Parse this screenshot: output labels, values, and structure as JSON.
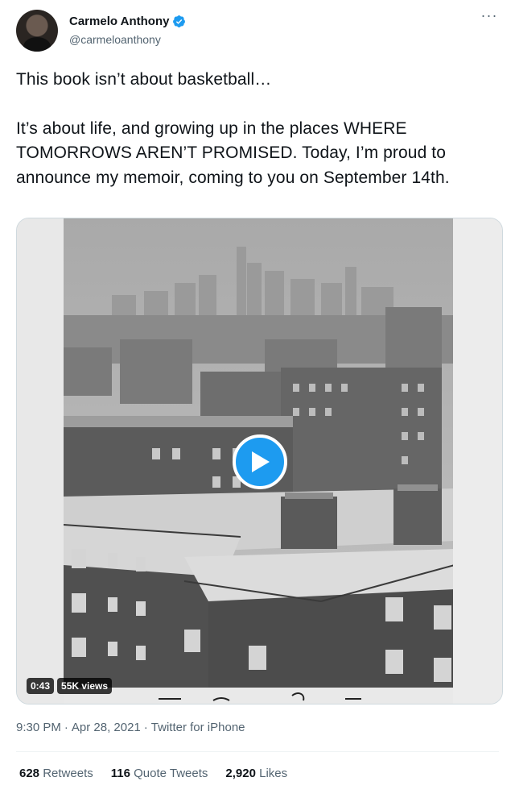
{
  "author": {
    "display_name": "Carmelo Anthony",
    "handle": "@carmeloanthony",
    "verified_icon": "verified-badge-icon",
    "more_icon": "more-options-icon"
  },
  "tweet": {
    "line1": "This book isn’t about basketball…",
    "line2": "It’s about life, and growing up in the places WHERE TOMORROWS AREN’T PROMISED. Today, I’m proud to announce my memoir, coming to you on September 14th."
  },
  "media": {
    "duration": "0:43",
    "views": "55K views",
    "play_icon": "play-icon"
  },
  "meta": {
    "time": "9:30 PM",
    "sep1": "·",
    "date": "Apr 28, 2021",
    "sep2": "·",
    "source": "Twitter for iPhone"
  },
  "stats": {
    "retweets_count": "628",
    "retweets_label": "Retweets",
    "quotes_count": "116",
    "quotes_label": "Quote Tweets",
    "likes_count": "2,920",
    "likes_label": "Likes"
  },
  "colors": {
    "accent": "#1d9bf0",
    "text_primary": "#0f1419",
    "text_secondary": "#536471"
  }
}
